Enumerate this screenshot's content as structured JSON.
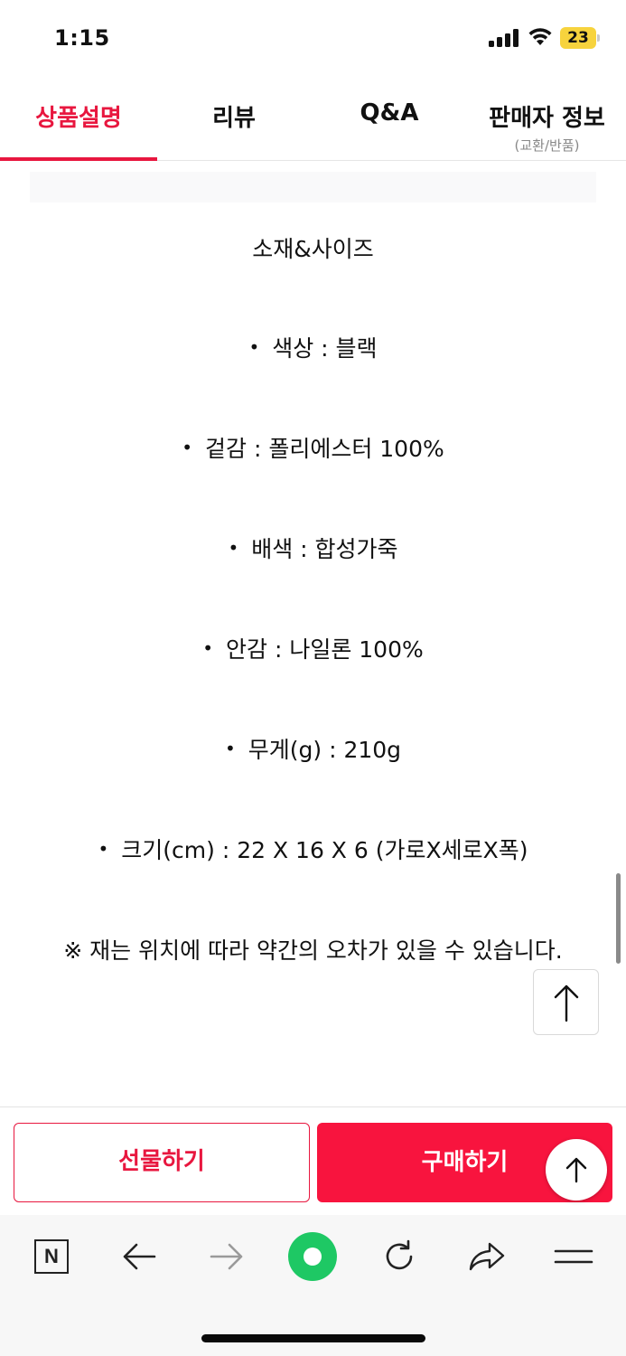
{
  "status_bar": {
    "time": "1:15",
    "battery": "23"
  },
  "tabs": [
    {
      "label": "상품설명",
      "sub": ""
    },
    {
      "label": "리뷰",
      "sub": ""
    },
    {
      "label": "Q&A",
      "sub": ""
    },
    {
      "label": "판매자 정보",
      "sub": "(교환/반품)"
    }
  ],
  "content": {
    "heading": "소재&사이즈",
    "bullet_symbol": "•",
    "specs": [
      "색상 : 블랙",
      "겉감 : 폴리에스터 100%",
      "배색 : 합성가죽",
      "안감 : 나일론 100%",
      "무게(g) : 210g",
      "크기(cm) : 22 X 16 X 6 (가로X세로X폭)"
    ],
    "note": "※ 재는 위치에 따라 약간의 오차가 있을 수 있습니다."
  },
  "purchase_bar": {
    "gift_label": "선물하기",
    "buy_label": "구매하기"
  },
  "browser_toolbar": {
    "logo_letter": "N"
  },
  "colors": {
    "accent": "#e8173f",
    "buy": "#f8143e",
    "green": "#1ec864"
  }
}
